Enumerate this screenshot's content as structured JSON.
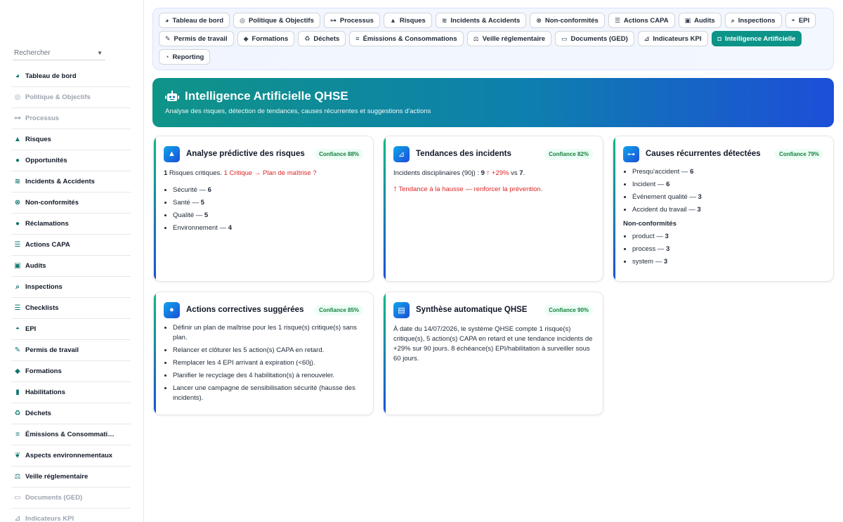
{
  "sidebar": {
    "search_placeholder": "Rechercher",
    "items": [
      {
        "label": "Tableau de bord",
        "icon": "gauge-icon",
        "glyph": "◕",
        "muted": false
      },
      {
        "label": "Politique & Objectifs",
        "icon": "target-icon",
        "glyph": "◎",
        "muted": true
      },
      {
        "label": "Processus",
        "icon": "sitemap-icon",
        "glyph": "⊶",
        "muted": true
      },
      {
        "label": "Risques",
        "icon": "warning-icon",
        "glyph": "▲",
        "muted": false
      },
      {
        "label": "Opportunités",
        "icon": "lightbulb-icon",
        "glyph": "●",
        "muted": false
      },
      {
        "label": "Incidents & Accidents",
        "icon": "car-crash-icon",
        "glyph": "≋",
        "muted": false
      },
      {
        "label": "Non-conformités",
        "icon": "times-circle-icon",
        "glyph": "⊗",
        "muted": false
      },
      {
        "label": "Réclamations",
        "icon": "comment-icon",
        "glyph": "●",
        "muted": false
      },
      {
        "label": "Actions CAPA",
        "icon": "list-icon",
        "glyph": "☰",
        "muted": false
      },
      {
        "label": "Audits",
        "icon": "clipboard-check-icon",
        "glyph": "▣",
        "muted": false
      },
      {
        "label": "Inspections",
        "icon": "search-icon",
        "glyph": "⌕",
        "muted": false
      },
      {
        "label": "Checklists",
        "icon": "list-check-icon",
        "glyph": "☰",
        "muted": false
      },
      {
        "label": "EPI",
        "icon": "hard-hat-icon",
        "glyph": "◓",
        "muted": false
      },
      {
        "label": "Permis de travail",
        "icon": "file-signature-icon",
        "glyph": "✎",
        "muted": false
      },
      {
        "label": "Formations",
        "icon": "graduation-cap-icon",
        "glyph": "◆",
        "muted": false
      },
      {
        "label": "Habilitations",
        "icon": "id-badge-icon",
        "glyph": "▮",
        "muted": false
      },
      {
        "label": "Déchets",
        "icon": "recycle-icon",
        "glyph": "♻",
        "muted": false
      },
      {
        "label": "Émissions & Consommati…",
        "icon": "smog-icon",
        "glyph": "≡",
        "muted": false
      },
      {
        "label": "Aspects environnementaux",
        "icon": "leaf-icon",
        "glyph": "❦",
        "muted": false
      },
      {
        "label": "Veille réglementaire",
        "icon": "balance-scale-icon",
        "glyph": "⚖",
        "muted": false
      },
      {
        "label": "Documents (GED)",
        "icon": "folder-open-icon",
        "glyph": "▭",
        "muted": true
      },
      {
        "label": "Indicateurs KPI",
        "icon": "chart-line-icon",
        "glyph": "⊿",
        "muted": true
      }
    ]
  },
  "topnav": {
    "tabs": [
      {
        "label": "Tableau de bord",
        "icon": "gauge-icon",
        "glyph": "◕",
        "active": false
      },
      {
        "label": "Politique & Objectifs",
        "icon": "target-icon",
        "glyph": "◎",
        "active": false
      },
      {
        "label": "Processus",
        "icon": "sitemap-icon",
        "glyph": "⊶",
        "active": false
      },
      {
        "label": "Risques",
        "icon": "warning-icon",
        "glyph": "▲",
        "active": false
      },
      {
        "label": "Incidents & Accidents",
        "icon": "car-crash-icon",
        "glyph": "≋",
        "active": false
      },
      {
        "label": "Non-conformités",
        "icon": "times-circle-icon",
        "glyph": "⊗",
        "active": false
      },
      {
        "label": "Actions CAPA",
        "icon": "list-icon",
        "glyph": "☰",
        "active": false
      },
      {
        "label": "Audits",
        "icon": "clipboard-check-icon",
        "glyph": "▣",
        "active": false
      },
      {
        "label": "Inspections",
        "icon": "search-icon",
        "glyph": "⌕",
        "active": false
      },
      {
        "label": "EPI",
        "icon": "hard-hat-icon",
        "glyph": "◓",
        "active": false
      },
      {
        "label": "Permis de travail",
        "icon": "file-signature-icon",
        "glyph": "✎",
        "active": false
      },
      {
        "label": "Formations",
        "icon": "graduation-cap-icon",
        "glyph": "◆",
        "active": false
      },
      {
        "label": "Déchets",
        "icon": "recycle-icon",
        "glyph": "♻",
        "active": false
      },
      {
        "label": "Émissions & Consommations",
        "icon": "smog-icon",
        "glyph": "≡",
        "active": false
      },
      {
        "label": "Veille réglementaire",
        "icon": "balance-scale-icon",
        "glyph": "⚖",
        "active": false
      },
      {
        "label": "Documents (GED)",
        "icon": "folder-open-icon",
        "glyph": "▭",
        "active": false
      },
      {
        "label": "Indicateurs KPI",
        "icon": "chart-line-icon",
        "glyph": "⊿",
        "active": false
      },
      {
        "label": "Intelligence Artificielle",
        "icon": "robot-icon",
        "glyph": "◘",
        "active": true
      },
      {
        "label": "Reporting",
        "icon": "chart-pie-icon",
        "glyph": "◔",
        "active": false
      }
    ]
  },
  "hero": {
    "title": "Intelligence Artificielle QHSE",
    "subtitle": "Analyse des risques, détection de tendances, causes récurrentes et suggestions d'actions"
  },
  "cards": {
    "risk": {
      "title": "Analyse prédictive des risques",
      "confidence": "Confiance 88%",
      "intro_count": "1",
      "intro_text": " Risques critiques. ",
      "intro_alert": "1 Critique → Plan de maîtrise ?",
      "items": [
        {
          "label": "Sécurité — ",
          "value": "6"
        },
        {
          "label": "Santé — ",
          "value": "5"
        },
        {
          "label": "Qualité — ",
          "value": "5"
        },
        {
          "label": "Environnement — ",
          "value": "4"
        }
      ]
    },
    "trends": {
      "title": "Tendances des incidents",
      "confidence": "Confiance 82%",
      "line_label": "Incidents disciplinaires (90j) : ",
      "current": "9",
      "arrow": " ↑ +29%",
      "vs": " vs ",
      "previous": "7",
      "end": ".",
      "alert": "🡑 Tendance à la hausse — renforcer la prévention."
    },
    "causes": {
      "title": "Causes récurrentes détectées",
      "confidence": "Confiance 79%",
      "items": [
        {
          "label": "Presqu'accident — ",
          "value": "6"
        },
        {
          "label": "Incident — ",
          "value": "6"
        },
        {
          "label": "Événement qualité — ",
          "value": "3"
        },
        {
          "label": "Accident du travail — ",
          "value": "3"
        }
      ],
      "nc_heading": "Non-conformités",
      "nc_items": [
        {
          "label": "product — ",
          "value": "3"
        },
        {
          "label": "process — ",
          "value": "3"
        },
        {
          "label": "system — ",
          "value": "3"
        }
      ]
    },
    "actions": {
      "title": "Actions correctives suggérées",
      "confidence": "Confiance 85%",
      "items": [
        "Définir un plan de maîtrise pour les 1 risque(s) critique(s) sans plan.",
        "Relancer et clôturer les 5 action(s) CAPA en retard.",
        "Remplacer les 4 EPI arrivant à expiration (<60j).",
        "Planifier le recyclage des 4 habilitation(s) à renouveler.",
        "Lancer une campagne de sensibilisation sécurité (hausse des incidents)."
      ]
    },
    "synthesis": {
      "title": "Synthèse automatique QHSE",
      "confidence": "Confiance 90%",
      "text": "À date du 14/07/2026, le système QHSE compte 1 risque(s) critique(s), 5 action(s) CAPA en retard et une tendance incidents de +29% sur 90 jours. 8 échéance(s) EPI/habilitation à surveiller sous 60 jours."
    }
  }
}
